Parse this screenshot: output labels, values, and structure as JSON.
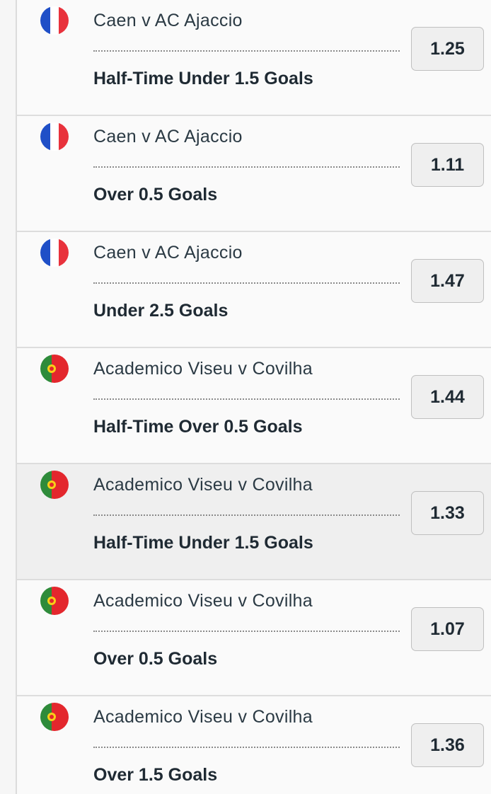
{
  "selections": [
    {
      "flag": "france-flag-icon",
      "match": "Caen v AC Ajaccio",
      "market": "Half-Time Under 1.5 Goals",
      "odds": "1.25"
    },
    {
      "flag": "france-flag-icon",
      "match": "Caen v AC Ajaccio",
      "market": "Over 0.5 Goals",
      "odds": "1.11"
    },
    {
      "flag": "france-flag-icon",
      "match": "Caen v AC Ajaccio",
      "market": "Under 2.5 Goals",
      "odds": "1.47"
    },
    {
      "flag": "portugal-flag-icon",
      "match": "Academico Viseu v Covilha",
      "market": "Half-Time Over 0.5 Goals",
      "odds": "1.44"
    },
    {
      "flag": "portugal-flag-icon",
      "match": "Academico Viseu v Covilha",
      "market": "Half-Time Under 1.5 Goals",
      "odds": "1.33"
    },
    {
      "flag": "portugal-flag-icon",
      "match": "Academico Viseu v Covilha",
      "market": "Over 0.5 Goals",
      "odds": "1.07"
    },
    {
      "flag": "portugal-flag-icon",
      "match": "Academico Viseu v Covilha",
      "market": "Over 1.5 Goals",
      "odds": "1.36"
    }
  ],
  "colors": {
    "france_blue": "#1f4fc7",
    "france_white": "#ffffff",
    "france_red": "#e8323c",
    "portugal_green": "#2e8b3a",
    "portugal_red": "#e3272d",
    "portugal_yellow": "#f7d117"
  }
}
